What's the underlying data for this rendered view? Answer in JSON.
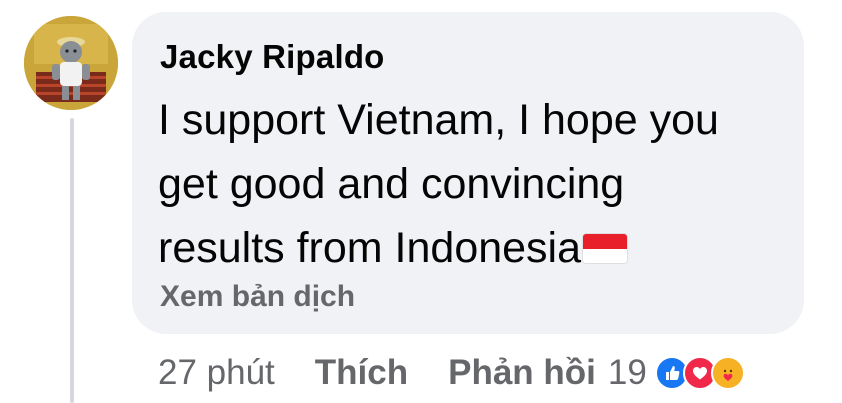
{
  "comment": {
    "author": "Jacky Ripaldo",
    "text_lines": [
      "I support Vietnam, I hope you",
      "get good and convincing",
      "results from Indonesia"
    ],
    "flag_icon": "indonesia-flag-icon",
    "translate_label": "Xem bản dịch"
  },
  "footer": {
    "time": "27 phút",
    "like_label": "Thích",
    "reply_label": "Phản hồi",
    "reaction_count": "19",
    "reactions": [
      "like-reaction-icon",
      "love-reaction-icon",
      "care-reaction-icon"
    ]
  },
  "colors": {
    "bubble": "#f0f2f5",
    "text": "#050505",
    "secondary": "#65676b",
    "like_blue": "#1877f2",
    "love_red": "#f02849",
    "care_yellow": "#f7b125"
  }
}
